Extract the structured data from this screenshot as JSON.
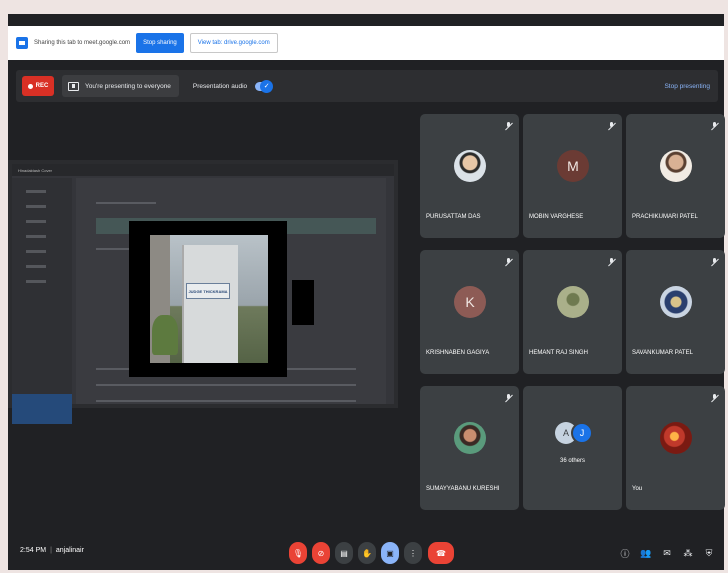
{
  "share_bar": {
    "message": "Sharing this tab to meet.google.com",
    "stop_sharing": "Stop sharing",
    "switch_tab": "View tab: drive.google.com"
  },
  "top_bar": {
    "rec": "REC",
    "presenting": "You're presenting to everyone",
    "presentation_audio": "Presentation audio",
    "stop_presenting": "Stop presenting"
  },
  "presentation": {
    "doc_title": "Hinadaktash Cover",
    "sign_text": "JUDGE THICKRAMA"
  },
  "participants": [
    {
      "name": "PURUSATTAM DAS",
      "initial": ""
    },
    {
      "name": "MOBIN VARGHESE",
      "initial": "M"
    },
    {
      "name": "PRACHIKUMARI PATEL",
      "initial": ""
    },
    {
      "name": "KRISHNABEN GAGIYA",
      "initial": "K"
    },
    {
      "name": "HEMANT RAJ SINGH",
      "initial": ""
    },
    {
      "name": "SAVANKUMAR PATEL",
      "initial": ""
    },
    {
      "name": "SUMAYYABANU KURESHI",
      "initial": ""
    },
    {
      "name": "You",
      "initial": ""
    }
  ],
  "others_tile": {
    "a": "A",
    "j": "J",
    "label": "36 others"
  },
  "bottom_bar": {
    "time": "2:54 PM",
    "separator": "|",
    "meeting": "anjalinair"
  },
  "colors": {
    "accent": "#1a73e8",
    "danger": "#ea4335",
    "panel": "#3c4043",
    "bg": "#202124"
  }
}
